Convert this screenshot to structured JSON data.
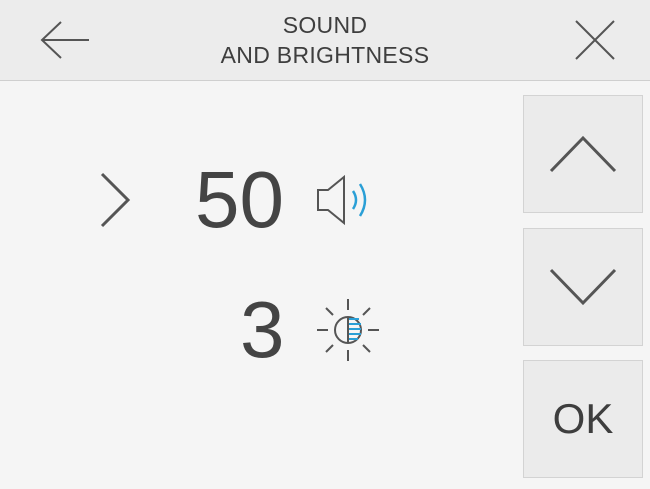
{
  "header": {
    "title_line1": "SOUND",
    "title_line2": "AND BRIGHTNESS",
    "back_icon": "arrow-left-icon",
    "close_icon": "close-icon"
  },
  "settings": {
    "sound": {
      "value": "50",
      "selected": true,
      "icon": "speaker-icon"
    },
    "brightness": {
      "value": "3",
      "selected": false,
      "icon": "sun-icon"
    }
  },
  "controls": {
    "up_icon": "chevron-up-icon",
    "down_icon": "chevron-down-icon",
    "ok_label": "OK"
  },
  "colors": {
    "accent": "#2a9fd6",
    "text": "#444444",
    "header_bg": "#ececec",
    "button_bg": "#ebebeb"
  }
}
